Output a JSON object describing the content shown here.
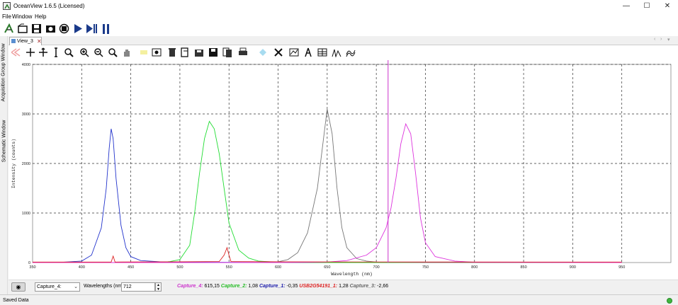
{
  "window": {
    "title": "OceanView 1.6.5 (Licensed)",
    "min_glyph": "—",
    "max_glyph": "☐",
    "close_glyph": "✕"
  },
  "menu": {
    "items": [
      "File",
      "Window",
      "Help"
    ]
  },
  "main_toolbar": {
    "icons": [
      "wizard-icon",
      "open-icon",
      "save-icon",
      "snapshot-icon",
      "device-icon",
      "play-icon",
      "step-icon",
      "pause-icon"
    ]
  },
  "side_panel": {
    "tabs": [
      "Acquisition Group Window",
      "Schematic Window"
    ]
  },
  "view": {
    "tab_label": "View_3",
    "tab_close": "✕",
    "nav_left": "‹",
    "nav_right": "›",
    "nav_menu": "▾"
  },
  "plot_toolbar": {
    "icons": [
      "undo-zoom-icon",
      "crosshair-icon",
      "move-icon",
      "cursor-icon",
      "zoom-fit-icon",
      "zoom-in-icon",
      "zoom-out-icon",
      "zoom-icon",
      "pan-icon",
      "highlight-icon",
      "camera-icon",
      "delete-icon",
      "export-icon",
      "save-graph-icon",
      "save-icon",
      "copy-icon",
      "print-icon",
      "overlay-icon",
      "tools-icon",
      "graph-icon",
      "peak-icon",
      "table-icon",
      "spectrum-icon",
      "waves-icon"
    ]
  },
  "chart_data": {
    "type": "line",
    "xlabel": "Wavelength (nm)",
    "ylabel": "Intensity (counts)",
    "xlim": [
      350,
      1000
    ],
    "ylim": [
      0,
      4000
    ],
    "x_ticks": [
      350,
      400,
      450,
      500,
      550,
      600,
      650,
      700,
      750,
      800,
      850,
      900,
      950
    ],
    "y_ticks": [
      0,
      1000,
      2000,
      3000,
      4000
    ],
    "grid": true,
    "cursor_x": 712,
    "series": [
      {
        "name": "Capture_1",
        "color": "#2233cc",
        "x": [
          350,
          380,
          400,
          410,
          420,
          425,
          428,
          430,
          432,
          435,
          440,
          445,
          450,
          460,
          480,
          500,
          550,
          600,
          650,
          700,
          950
        ],
        "y": [
          0,
          5,
          30,
          150,
          700,
          1500,
          2300,
          2700,
          2500,
          1700,
          750,
          300,
          120,
          40,
          15,
          8,
          4,
          2,
          1,
          0,
          0
        ]
      },
      {
        "name": "Capture_2",
        "color": "#22dd33",
        "x": [
          350,
          480,
          490,
          500,
          510,
          515,
          520,
          525,
          530,
          535,
          540,
          545,
          550,
          560,
          570,
          580,
          600,
          650,
          950
        ],
        "y": [
          0,
          0,
          20,
          60,
          350,
          1000,
          1800,
          2500,
          2850,
          2700,
          2200,
          1500,
          800,
          250,
          90,
          30,
          5,
          0,
          0
        ]
      },
      {
        "name": "Capture_3",
        "color": "#777777",
        "x": [
          350,
          580,
          600,
          610,
          620,
          630,
          640,
          645,
          650,
          655,
          660,
          665,
          670,
          680,
          690,
          700,
          750,
          950
        ],
        "y": [
          0,
          0,
          15,
          60,
          200,
          600,
          1500,
          2300,
          3100,
          2600,
          1500,
          700,
          300,
          80,
          30,
          10,
          0,
          0
        ]
      },
      {
        "name": "Capture_4",
        "color": "#dd33dd",
        "x": [
          350,
          600,
          650,
          670,
          690,
          700,
          710,
          715,
          720,
          725,
          730,
          735,
          740,
          745,
          750,
          760,
          780,
          800,
          950
        ],
        "y": [
          0,
          0,
          10,
          40,
          150,
          300,
          700,
          1100,
          1700,
          2400,
          2800,
          2600,
          1800,
          900,
          400,
          120,
          30,
          5,
          0
        ]
      },
      {
        "name": "USB2G54191_1",
        "color": "#dd2222",
        "x": [
          350,
          430,
          432,
          434,
          440,
          500,
          540,
          545,
          548,
          550,
          552,
          556,
          600,
          700,
          950
        ],
        "y": [
          10,
          10,
          130,
          10,
          12,
          15,
          20,
          150,
          300,
          150,
          20,
          18,
          15,
          12,
          10
        ]
      }
    ]
  },
  "bottom_bar": {
    "eye_glyph": "◉",
    "combo_value": "Capture_4:",
    "combo_arrow": "⌄",
    "wavelength_label": "Wavelengths (nm)",
    "wavelength_value": "712",
    "spin_up": "▲",
    "spin_down": "▼",
    "readouts": [
      {
        "name": "Capture_4:",
        "value": "615,15",
        "color": "#cc33cc"
      },
      {
        "name": "Capture_2:",
        "value": "1,08",
        "color": "#22bb22"
      },
      {
        "name": "Capture_1:",
        "value": "-0,35",
        "color": "#1a1aaa"
      },
      {
        "name": "USB2G54191_1:",
        "value": "1,28",
        "color": "#dd2222"
      },
      {
        "name": "Capture_3:",
        "value": "-2,66",
        "color": "#666666"
      }
    ]
  },
  "status": {
    "text": "Saved Data"
  }
}
